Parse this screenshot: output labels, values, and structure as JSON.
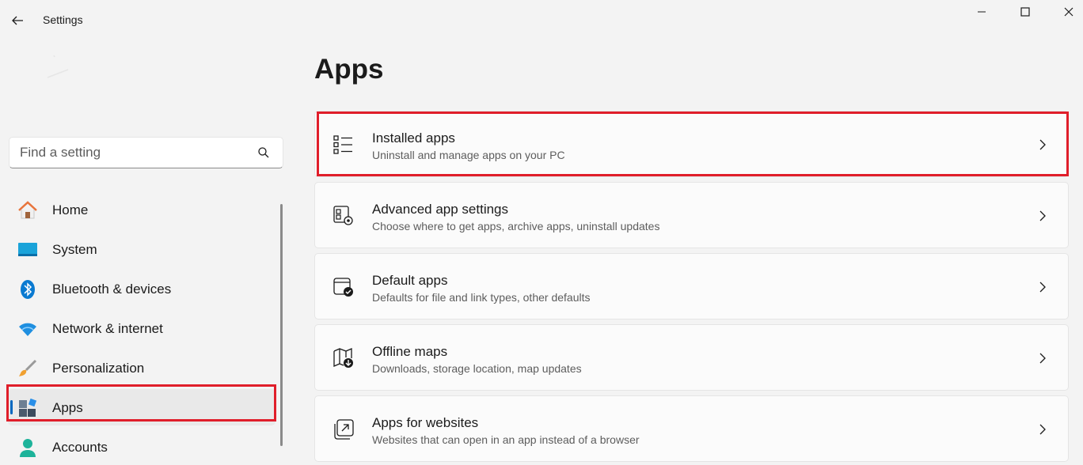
{
  "titlebar": {
    "app_title": "Settings"
  },
  "search": {
    "placeholder": "Find a setting"
  },
  "sidebar": {
    "items": [
      {
        "label": "Home",
        "icon": "home-icon"
      },
      {
        "label": "System",
        "icon": "system-icon"
      },
      {
        "label": "Bluetooth & devices",
        "icon": "bluetooth-icon"
      },
      {
        "label": "Network & internet",
        "icon": "wifi-icon"
      },
      {
        "label": "Personalization",
        "icon": "brush-icon"
      },
      {
        "label": "Apps",
        "icon": "apps-icon",
        "selected": true
      },
      {
        "label": "Accounts",
        "icon": "accounts-icon"
      }
    ]
  },
  "main": {
    "title": "Apps",
    "cards": [
      {
        "title": "Installed apps",
        "subtitle": "Uninstall and manage apps on your PC",
        "icon": "list-icon",
        "highlighted": true
      },
      {
        "title": "Advanced app settings",
        "subtitle": "Choose where to get apps, archive apps, uninstall updates",
        "icon": "app-settings-icon"
      },
      {
        "title": "Default apps",
        "subtitle": "Defaults for file and link types, other defaults",
        "icon": "default-apps-icon"
      },
      {
        "title": "Offline maps",
        "subtitle": "Downloads, storage location, map updates",
        "icon": "map-icon"
      },
      {
        "title": "Apps for websites",
        "subtitle": "Websites that can open in an app instead of a browser",
        "icon": "open-in-app-icon"
      }
    ]
  },
  "colors": {
    "accent": "#0067c0",
    "highlight": "#e01e2a",
    "background": "#f3f3f3",
    "card": "#fbfbfb"
  }
}
